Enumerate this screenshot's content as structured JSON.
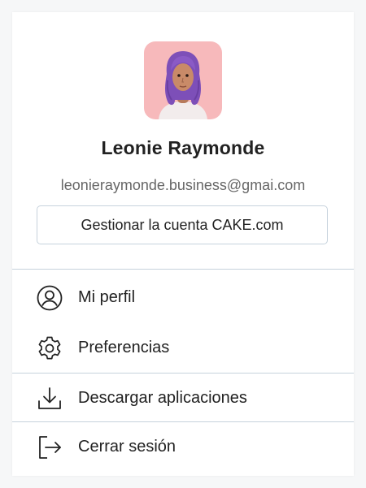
{
  "profile": {
    "name": "Leonie Raymonde",
    "email": "leonieraymonde.business@gmai.com",
    "manage_label": "Gestionar la cuenta CAKE.com",
    "avatar_icon": "avatar-3d-purple-hair",
    "avatar_bg": "#f7b9bb"
  },
  "menu": {
    "profile_label": "Mi perfil",
    "profile_icon": "user-circle-icon",
    "preferences_label": "Preferencias",
    "preferences_icon": "gear-icon",
    "download_label": "Descargar aplicaciones",
    "download_icon": "download-icon",
    "logout_label": "Cerrar sesión",
    "logout_icon": "logout-icon"
  },
  "colors": {
    "divider": "#c6d2dc",
    "text": "#222222",
    "secondary_text": "#666666"
  }
}
